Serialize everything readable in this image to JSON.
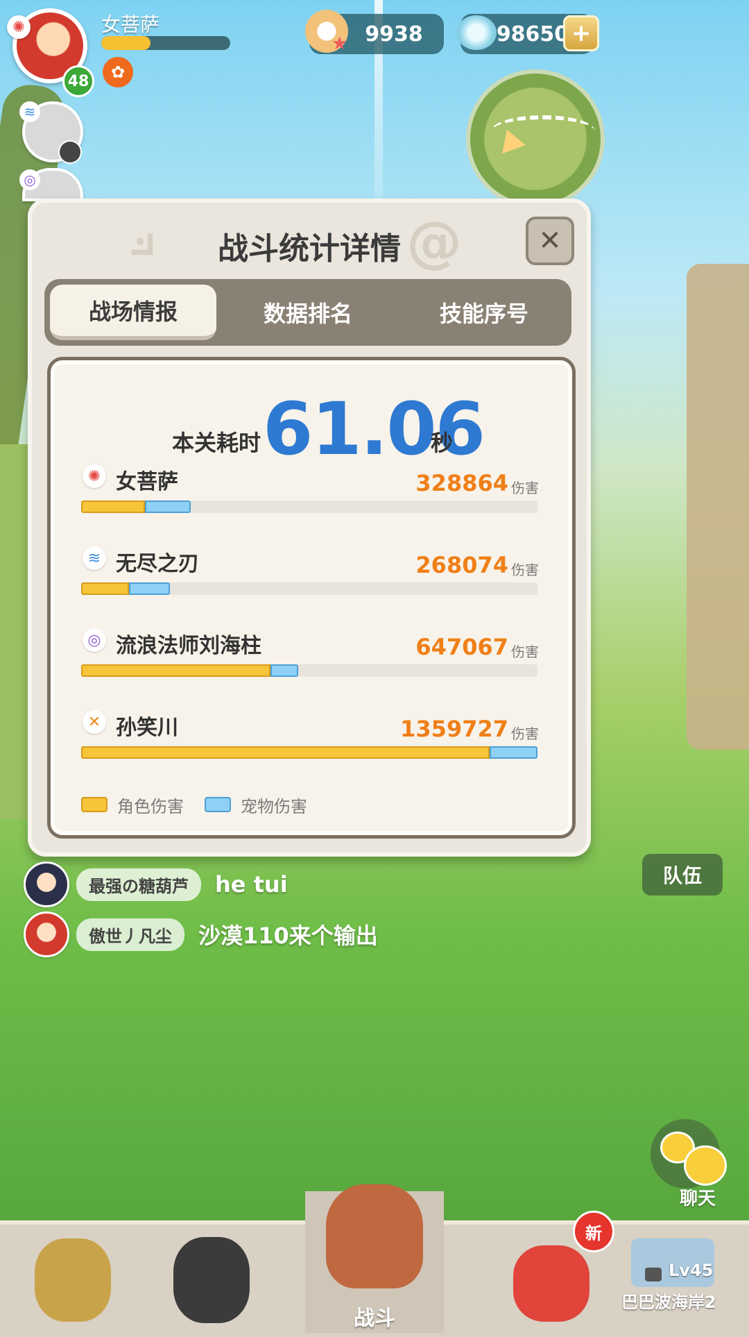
{
  "player": {
    "name": "女菩萨",
    "level": "48",
    "hp_fraction": 0.38
  },
  "currency": {
    "pearl": "9938",
    "shell": "98650"
  },
  "dialog": {
    "title": "战斗统计详情",
    "tabs": [
      {
        "label": "战场情报",
        "active": true
      },
      {
        "label": "数据排名",
        "active": false
      },
      {
        "label": "技能序号",
        "active": false
      }
    ],
    "time_label": "本关耗时",
    "time_value": "61.06",
    "time_unit": "秒",
    "rows": [
      {
        "name": "女菩萨",
        "element_icon": "fire-icon",
        "element_color": "#e64b45",
        "damage": "328864",
        "unit": "伤害",
        "char_fraction": 0.14,
        "pet_fraction": 0.1
      },
      {
        "name": "无尽之刃",
        "element_icon": "wind-icon",
        "element_color": "#3c8fe0",
        "damage": "268074",
        "unit": "伤害",
        "char_fraction": 0.105,
        "pet_fraction": 0.09
      },
      {
        "name": "流浪法师刘海柱",
        "element_icon": "vortex-icon",
        "element_color": "#8d5ad6",
        "damage": "647067",
        "unit": "伤害",
        "char_fraction": 0.415,
        "pet_fraction": 0.06
      },
      {
        "name": "孙笑川",
        "element_icon": "lightning-icon",
        "element_color": "#f08a1c",
        "damage": "1359727",
        "unit": "伤害",
        "char_fraction": 0.895,
        "pet_fraction": 0.105
      }
    ],
    "legend": [
      {
        "label": "角色伤害",
        "color": "#f7c53a"
      },
      {
        "label": "宠物伤害",
        "color": "#8fd1f6"
      }
    ]
  },
  "chat": [
    {
      "name": "最强の糖葫芦",
      "message": "he tui"
    },
    {
      "name": "傲世丿凡尘",
      "message": "沙漠110来个输出"
    }
  ],
  "side_buttons": {
    "team": "队伍",
    "chat": "聊天"
  },
  "nav": {
    "battle_label": "战斗",
    "new_badge": "新",
    "locked_level": "Lv45",
    "locked_name": "巴巴波海岸2"
  },
  "colors": {
    "damage_number": "#f07f17",
    "time_number": "#2e79d2"
  }
}
